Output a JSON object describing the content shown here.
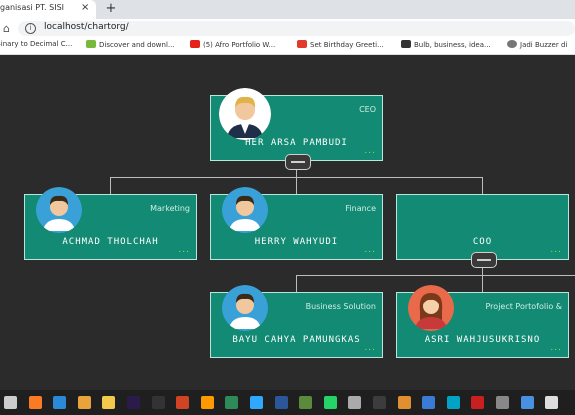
{
  "browser": {
    "tab_title": "ganisasi PT. SISI",
    "tab_close": "×",
    "new_tab": "+",
    "url": "localhost/chartorg/",
    "bookmarks": [
      {
        "label": "Binary to Decimal C...",
        "icon": "bookmark-icon",
        "color": "#6d8fb8"
      },
      {
        "label": "Discover and downl...",
        "icon": "px-icon",
        "color": "#78b83a"
      },
      {
        "label": "(5) Afro Portfolio W...",
        "icon": "youtube-icon",
        "color": "#e62117"
      },
      {
        "label": "Set Birthday Greeti...",
        "icon": "app-icon",
        "color": "#e23b2b"
      },
      {
        "label": "Bulb, business, idea...",
        "icon": "bulb-icon",
        "color": "#333333"
      },
      {
        "label": "Jadi Buzzer di",
        "icon": "globe-icon",
        "color": "#777777"
      }
    ]
  },
  "org": {
    "ceo": {
      "title": "CEO",
      "name": "HER ARSA PAMBUDI"
    },
    "marketing": {
      "title": "Marketing",
      "name": "ACHMAD THOLCHAH"
    },
    "finance": {
      "title": "Finance",
      "name": "HERRY WAHYUDI"
    },
    "coo": {
      "title": "",
      "name": "COO"
    },
    "business": {
      "title": "Business Solution",
      "name": "BAYU CAHYA PAMUNGKAS"
    },
    "portfolio": {
      "title": "Project Portofolio &",
      "name": "ASRI WAHJUSUKRISNO"
    },
    "more": "..."
  },
  "colors": {
    "node": "#138a74",
    "node_border": "#b9e6dc",
    "dots": "#9be04a",
    "background": "#2b2b2b"
  },
  "taskbar": {
    "icons": [
      {
        "name": "task-view-icon",
        "color": "#cccccc"
      },
      {
        "name": "xampp-icon",
        "color": "#fb7a24"
      },
      {
        "name": "vscode-icon",
        "color": "#2b8ad8"
      },
      {
        "name": "chrome-icon",
        "color": "#e8a33c"
      },
      {
        "name": "explorer-icon",
        "color": "#f2c94c"
      },
      {
        "name": "premiere-icon",
        "color": "#2a1b4b"
      },
      {
        "name": "camera-icon",
        "color": "#333333"
      },
      {
        "name": "powerpoint-icon",
        "color": "#d04423"
      },
      {
        "name": "illustrator-icon",
        "color": "#ff9a00"
      },
      {
        "name": "app-u-icon",
        "color": "#2e8b57"
      },
      {
        "name": "photoshop-icon",
        "color": "#31a8ff"
      },
      {
        "name": "word-icon",
        "color": "#2b579a"
      },
      {
        "name": "app-green-icon",
        "color": "#5b8a3c"
      },
      {
        "name": "whatsapp-icon",
        "color": "#25d366"
      },
      {
        "name": "app-arrow-icon",
        "color": "#aaaaaa"
      },
      {
        "name": "terminal-icon",
        "color": "#3c3c3c"
      },
      {
        "name": "app-orange-icon",
        "color": "#e09030"
      },
      {
        "name": "app-blue-icon",
        "color": "#3a7bd5"
      },
      {
        "name": "app-cyan-icon",
        "color": "#00a3c4"
      },
      {
        "name": "app-red-icon",
        "color": "#c82020"
      },
      {
        "name": "app-gray-icon",
        "color": "#888888"
      },
      {
        "name": "app-blue2-icon",
        "color": "#4a90e2"
      },
      {
        "name": "app-white-icon",
        "color": "#dddddd"
      }
    ]
  }
}
